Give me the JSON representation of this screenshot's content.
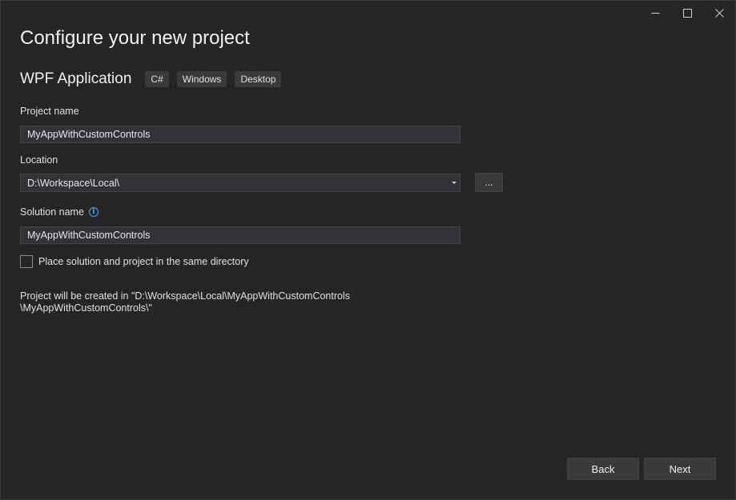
{
  "window_controls": {
    "minimize": "—",
    "maximize": "☐",
    "close": "✕"
  },
  "header": {
    "title": "Configure your new project"
  },
  "template": {
    "name": "WPF Application",
    "tags": [
      "C#",
      "Windows",
      "Desktop"
    ]
  },
  "form": {
    "project_name_label": "Project name",
    "project_name_value": "MyAppWithCustomControls",
    "location_label": "Location",
    "location_value": "D:\\Workspace\\Local\\",
    "browse_label": "...",
    "solution_name_label": "Solution name",
    "solution_name_value": "MyAppWithCustomControls",
    "same_dir_label": "Place solution and project in the same directory",
    "same_dir_checked": false
  },
  "summary": {
    "line1": "Project will be created in \"D:\\Workspace\\Local\\MyAppWithCustomControls",
    "line2": "\\MyAppWithCustomControls\\\""
  },
  "footer": {
    "back_label": "Back",
    "next_label": "Next"
  },
  "colors": {
    "accent_info": "#4aa3e8",
    "background": "#252526"
  }
}
